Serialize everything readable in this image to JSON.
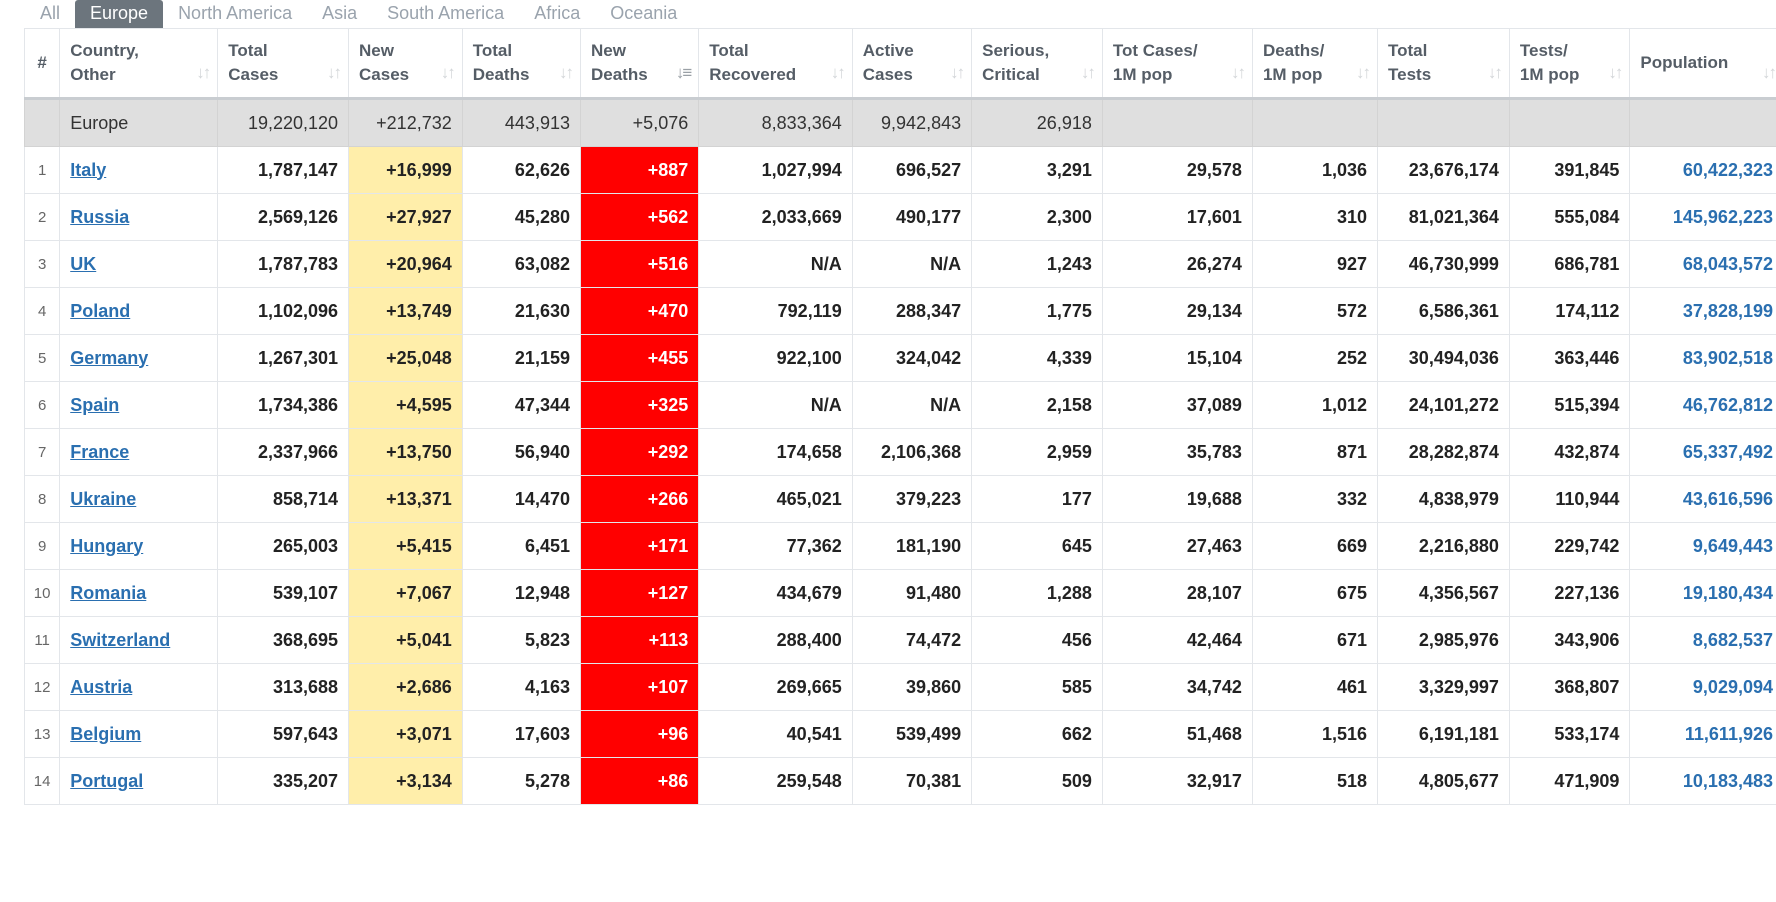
{
  "tabs": [
    "All",
    "Europe",
    "North America",
    "Asia",
    "South America",
    "Africa",
    "Oceania"
  ],
  "active_tab": "Europe",
  "colors": {
    "new_cases_bg": "#ffeeaa",
    "new_deaths_bg": "#ff0000",
    "link": "#2a6fb0",
    "summary_bg": "#dfdfdf"
  },
  "headers": [
    {
      "l1": "#",
      "l2": ""
    },
    {
      "l1": "Country,",
      "l2": "Other"
    },
    {
      "l1": "Total",
      "l2": "Cases"
    },
    {
      "l1": "New",
      "l2": "Cases"
    },
    {
      "l1": "Total",
      "l2": "Deaths"
    },
    {
      "l1": "New",
      "l2": "Deaths"
    },
    {
      "l1": "Total",
      "l2": "Recovered"
    },
    {
      "l1": "Active",
      "l2": "Cases"
    },
    {
      "l1": "Serious,",
      "l2": "Critical"
    },
    {
      "l1": "Tot Cases/",
      "l2": "1M pop"
    },
    {
      "l1": "Deaths/",
      "l2": "1M pop"
    },
    {
      "l1": "Total",
      "l2": "Tests"
    },
    {
      "l1": "Tests/",
      "l2": "1M pop"
    },
    {
      "l1": "",
      "l2": "Population"
    }
  ],
  "summary": [
    "",
    "Europe",
    "19,220,120",
    "+212,732",
    "443,913",
    "+5,076",
    "8,833,364",
    "9,942,843",
    "26,918",
    "",
    "",
    "",
    "",
    ""
  ],
  "rows": [
    [
      "1",
      "Italy",
      "1,787,147",
      "+16,999",
      "62,626",
      "+887",
      "1,027,994",
      "696,527",
      "3,291",
      "29,578",
      "1,036",
      "23,676,174",
      "391,845",
      "60,422,323"
    ],
    [
      "2",
      "Russia",
      "2,569,126",
      "+27,927",
      "45,280",
      "+562",
      "2,033,669",
      "490,177",
      "2,300",
      "17,601",
      "310",
      "81,021,364",
      "555,084",
      "145,962,223"
    ],
    [
      "3",
      "UK",
      "1,787,783",
      "+20,964",
      "63,082",
      "+516",
      "N/A",
      "N/A",
      "1,243",
      "26,274",
      "927",
      "46,730,999",
      "686,781",
      "68,043,572"
    ],
    [
      "4",
      "Poland",
      "1,102,096",
      "+13,749",
      "21,630",
      "+470",
      "792,119",
      "288,347",
      "1,775",
      "29,134",
      "572",
      "6,586,361",
      "174,112",
      "37,828,199"
    ],
    [
      "5",
      "Germany",
      "1,267,301",
      "+25,048",
      "21,159",
      "+455",
      "922,100",
      "324,042",
      "4,339",
      "15,104",
      "252",
      "30,494,036",
      "363,446",
      "83,902,518"
    ],
    [
      "6",
      "Spain",
      "1,734,386",
      "+4,595",
      "47,344",
      "+325",
      "N/A",
      "N/A",
      "2,158",
      "37,089",
      "1,012",
      "24,101,272",
      "515,394",
      "46,762,812"
    ],
    [
      "7",
      "France",
      "2,337,966",
      "+13,750",
      "56,940",
      "+292",
      "174,658",
      "2,106,368",
      "2,959",
      "35,783",
      "871",
      "28,282,874",
      "432,874",
      "65,337,492"
    ],
    [
      "8",
      "Ukraine",
      "858,714",
      "+13,371",
      "14,470",
      "+266",
      "465,021",
      "379,223",
      "177",
      "19,688",
      "332",
      "4,838,979",
      "110,944",
      "43,616,596"
    ],
    [
      "9",
      "Hungary",
      "265,003",
      "+5,415",
      "6,451",
      "+171",
      "77,362",
      "181,190",
      "645",
      "27,463",
      "669",
      "2,216,880",
      "229,742",
      "9,649,443"
    ],
    [
      "10",
      "Romania",
      "539,107",
      "+7,067",
      "12,948",
      "+127",
      "434,679",
      "91,480",
      "1,288",
      "28,107",
      "675",
      "4,356,567",
      "227,136",
      "19,180,434"
    ],
    [
      "11",
      "Switzerland",
      "368,695",
      "+5,041",
      "5,823",
      "+113",
      "288,400",
      "74,472",
      "456",
      "42,464",
      "671",
      "2,985,976",
      "343,906",
      "8,682,537"
    ],
    [
      "12",
      "Austria",
      "313,688",
      "+2,686",
      "4,163",
      "+107",
      "269,665",
      "39,860",
      "585",
      "34,742",
      "461",
      "3,329,997",
      "368,807",
      "9,029,094"
    ],
    [
      "13",
      "Belgium",
      "597,643",
      "+3,071",
      "17,603",
      "+96",
      "40,541",
      "539,499",
      "662",
      "51,468",
      "1,516",
      "6,191,181",
      "533,174",
      "11,611,926"
    ],
    [
      "14",
      "Portugal",
      "335,207",
      "+3,134",
      "5,278",
      "+86",
      "259,548",
      "70,381",
      "509",
      "32,917",
      "518",
      "4,805,677",
      "471,909",
      "10,183,483"
    ]
  ]
}
